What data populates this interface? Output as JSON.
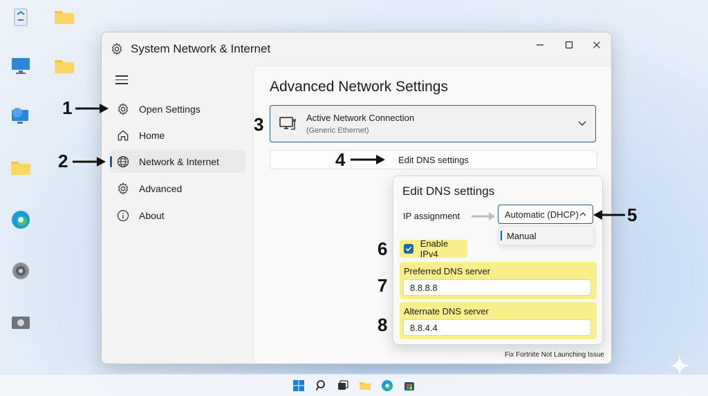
{
  "window": {
    "title": "System  Network & Internet",
    "controls": {
      "minimize": "–",
      "maximize": "☐",
      "close": "✕"
    }
  },
  "sidebar": {
    "items": [
      {
        "label": "Open Settings",
        "icon": "gear-icon"
      },
      {
        "label": "Home",
        "icon": "home-icon"
      },
      {
        "label": "Network & Internet",
        "icon": "globe-icon",
        "active": true
      },
      {
        "label": "Advanced",
        "icon": "gear-icon"
      },
      {
        "label": "About",
        "icon": "info-icon"
      }
    ]
  },
  "main": {
    "title": "Advanced Network Settings",
    "connection": {
      "title": "Active Network Connection",
      "subtitle": "(Generic Ethernet)"
    },
    "edit_dns_button": "Edit DNS settings"
  },
  "dns_panel": {
    "title": "Edit DNS settings",
    "ip_assignment_label": "IP assignment",
    "ip_assignment_value": "Automatic (DHCP)",
    "ip_assignment_options": [
      "Manual"
    ],
    "enable_ipv4_label": "Enable IPv4",
    "enable_ipv4_checked": true,
    "preferred_dns_label": "Preferred DNS server",
    "preferred_dns_value": "8.8.8.8",
    "alternate_dns_label": "Alternate DNS server",
    "alternate_dns_value": "8.8.4.4"
  },
  "callouts": [
    "1",
    "2",
    "3",
    "4",
    "5",
    "6",
    "7",
    "8"
  ],
  "caption": "Fix Fortnite Not Launching Issue",
  "colors": {
    "accent": "#005fb8",
    "highlight": "#f8ef8b",
    "focus_border": "#2d5a7c",
    "checkbox": "#1f6aa5"
  }
}
